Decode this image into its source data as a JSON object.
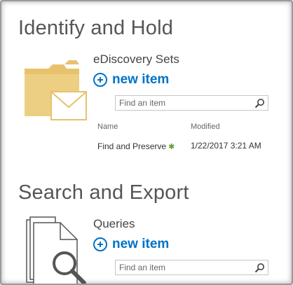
{
  "identify": {
    "title": "Identify and Hold",
    "list_title": "eDiscovery Sets",
    "new_item_label": "new item",
    "search_placeholder": "Find an item",
    "columns": [
      "Name",
      "Modified"
    ],
    "rows": [
      {
        "name": "Find and Preserve",
        "new_badge": "✱",
        "modified": "1/22/2017 3:21 AM"
      }
    ]
  },
  "search_export": {
    "title": "Search and Export",
    "list_title": "Queries",
    "new_item_label": "new item",
    "search_placeholder": "Find an item"
  },
  "icons": {
    "folder": "folder-with-envelope-icon",
    "documents": "documents-magnifier-icon",
    "search": "search-icon",
    "add": "plus-circle-icon"
  },
  "colors": {
    "accent": "#0072c6",
    "folder": "#e9c46a",
    "new_badge": "#5aa02c"
  }
}
